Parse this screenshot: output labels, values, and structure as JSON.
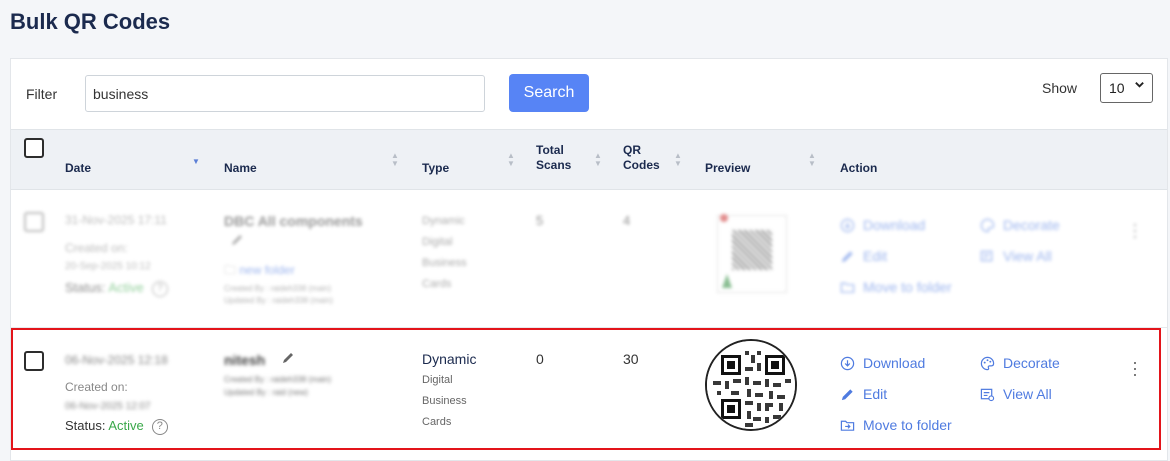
{
  "page": {
    "title": "Bulk QR Codes"
  },
  "filter": {
    "label": "Filter",
    "value": "business",
    "search_label": "Search",
    "show_label": "Show",
    "show_value": "10"
  },
  "table": {
    "headers": {
      "date": "Date",
      "name": "Name",
      "type": "Type",
      "total_scans_1": "Total",
      "total_scans_2": "Scans",
      "qr_codes_1": "QR",
      "qr_codes_2": "Codes",
      "preview": "Preview",
      "action": "Action"
    },
    "rows": [
      {
        "date": "31-Nov-2025 17:11",
        "created_label": "Created on:",
        "created_value": "20-Sep-2025 10:12",
        "status_label": "Status:",
        "status_value": "Active",
        "name": "DBC All components",
        "folder": "new folder",
        "created_by": "Created By : raideh338 (main)",
        "updated_by": "Updated By : raideh338 (main)",
        "type": [
          "Dynamic",
          "Digital",
          "Business",
          "Cards"
        ],
        "total_scans": "5",
        "qr_codes": "4",
        "actions": {
          "download": "Download",
          "edit": "Edit",
          "move": "Move to folder",
          "decorate": "Decorate",
          "view_all": "View All"
        }
      },
      {
        "date": "06-Nov-2025 12:18",
        "created_label": "Created on:",
        "created_value": "06-Nov-2025 12:07",
        "status_label": "Status:",
        "status_value": "Active",
        "name": "nitesh",
        "created_by": "Created By : raideh338 (main)",
        "updated_by": "Updated By : raid (new)",
        "type": [
          "Dynamic",
          "Digital",
          "Business",
          "Cards"
        ],
        "total_scans": "0",
        "qr_codes": "30",
        "actions": {
          "download": "Download",
          "edit": "Edit",
          "move": "Move to folder",
          "decorate": "Decorate",
          "view_all": "View All"
        }
      }
    ]
  },
  "colors": {
    "accent": "#5784f5",
    "link": "#4f7be0",
    "active": "#3aa84a",
    "highlight": "#e3141a",
    "heading": "#1b2a4e"
  }
}
